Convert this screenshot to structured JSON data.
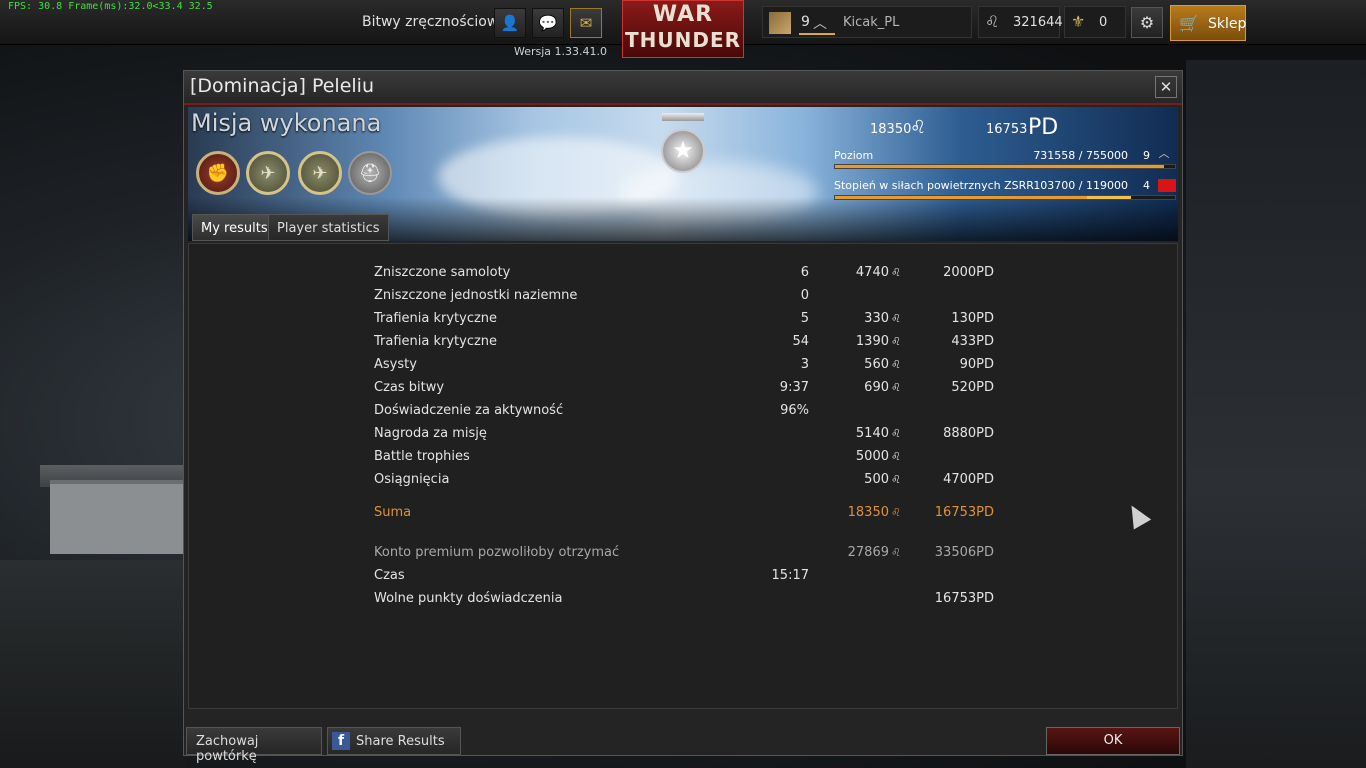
{
  "fps_text": "FPS: 30.8 Frame(ms):32.0<33.4 32.5",
  "topbar": {
    "battle_mode": "Bitwy zręcznościowe",
    "version": "Wersja 1.33.41.0",
    "logo_line1": "WAR",
    "logo_line2": "THUNDER",
    "player_level": "9",
    "player_name": "Kicak_PL",
    "lions": "321644",
    "eagles": "0",
    "shop_label": "Sklep"
  },
  "window": {
    "title": "[Dominacja] Peleliu",
    "close": "✕",
    "mission_status": "Misja wykonana",
    "summary_lions": "18350",
    "summary_rp": "16753",
    "summary_rp_unit": "PD",
    "progress": [
      {
        "label": "Poziom",
        "value": "731558 / 755000",
        "rank": "9",
        "fill": 0.969
      },
      {
        "label": "Stopień w siłach powietrznych ZSRR",
        "value": "103700 / 119000",
        "rank": "4",
        "fill": 0.742,
        "fill_new": 0.871
      }
    ],
    "tabs": [
      "My results",
      "Player statistics"
    ]
  },
  "results": [
    {
      "label": "Zniszczone samoloty",
      "count": "6",
      "lions": "4740",
      "rp": "2000PD"
    },
    {
      "label": "Zniszczone jednostki naziemne",
      "count": "0",
      "lions": "",
      "rp": ""
    },
    {
      "label": "Trafienia krytyczne",
      "count": "5",
      "lions": "330",
      "rp": "130PD"
    },
    {
      "label": "Trafienia krytyczne",
      "count": "54",
      "lions": "1390",
      "rp": "433PD"
    },
    {
      "label": "Asysty",
      "count": "3",
      "lions": "560",
      "rp": "90PD"
    },
    {
      "label": "Czas bitwy",
      "count": "9:37",
      "lions": "690",
      "rp": "520PD"
    },
    {
      "label": "Doświadczenie za aktywność",
      "count": "96%",
      "lions": "",
      "rp": ""
    },
    {
      "label": "Nagroda za misję",
      "count": "",
      "lions": "5140",
      "rp": "8880PD"
    },
    {
      "label": "Battle trophies",
      "count": "",
      "lions": "5000",
      "rp": ""
    },
    {
      "label": "Osiągnięcia",
      "count": "",
      "lions": "500",
      "rp": "4700PD"
    }
  ],
  "total": {
    "label": "Suma",
    "lions": "18350",
    "rp": "16753PD"
  },
  "extras": [
    {
      "label": "Konto premium pozwoliłoby otrzymać",
      "count": "",
      "lions": "27869",
      "rp": "33506PD"
    },
    {
      "label": "Czas",
      "count": "15:17",
      "lions": "",
      "rp": ""
    },
    {
      "label": "Wolne punkty doświadczenia",
      "count": "",
      "lions": "",
      "rp": "16753PD"
    }
  ],
  "buttons": {
    "save_replay": "Zachowaj powtórkę",
    "share": "Share Results",
    "ok": "OK"
  },
  "colors": {
    "accent_orange": "#e0913a",
    "window_border": "#7a1c1c"
  }
}
